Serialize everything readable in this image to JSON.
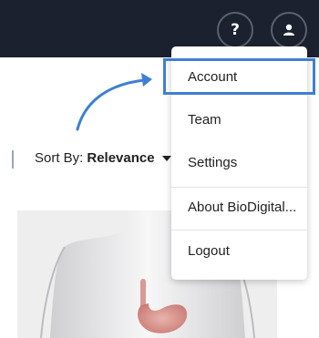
{
  "header": {
    "help_icon": "question-mark-icon",
    "help_glyph": "?",
    "user_icon": "user-icon"
  },
  "sort": {
    "label": "Sort By:",
    "value": "Relevance"
  },
  "account_menu": {
    "items": [
      "Account",
      "Team",
      "Settings",
      "About BioDigital...",
      "Logout"
    ]
  },
  "colors": {
    "header_bg": "#1c2130",
    "highlight": "#3f7fd2",
    "arrow": "#3f7fd2"
  }
}
